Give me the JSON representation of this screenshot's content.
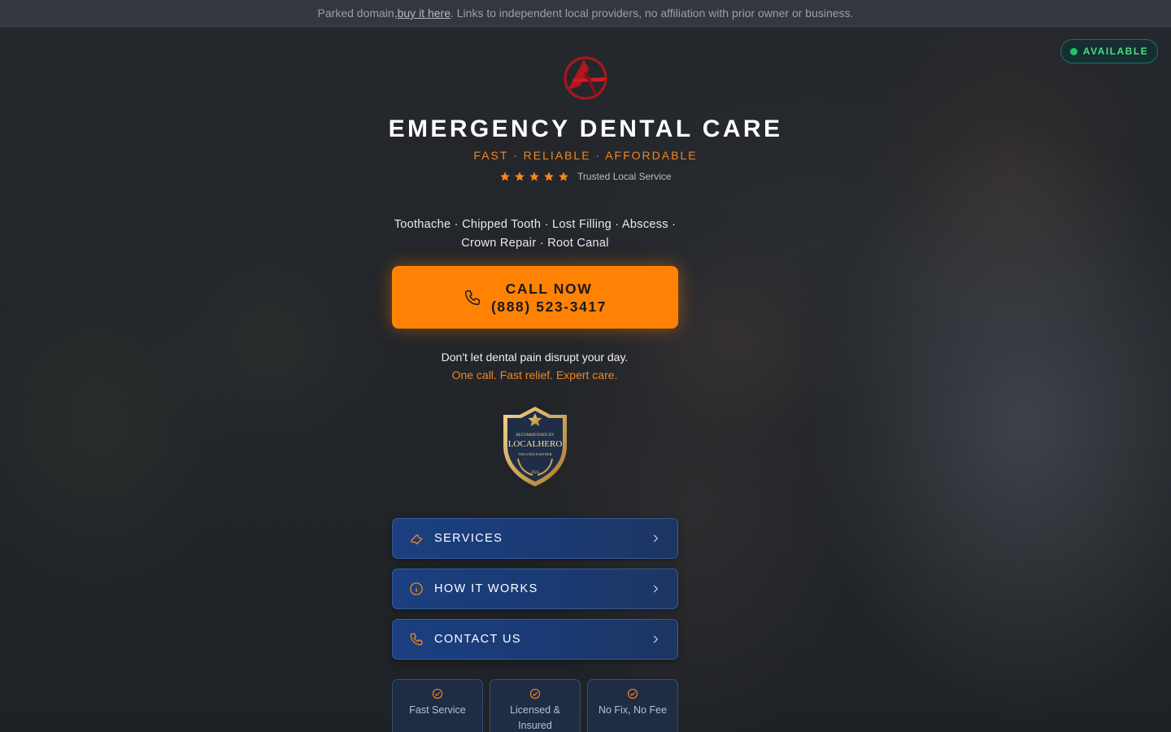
{
  "top_notice": {
    "prefix": "Parked domain, ",
    "link_label": "buy it here",
    "suffix": ". Links to independent local providers, no affiliation with prior owner or business."
  },
  "status_badge": {
    "label": "AVAILABLE",
    "color": "#22c55e"
  },
  "brand": {
    "title": "EMERGENCY DENTAL CARE",
    "tagline": "FAST · RELIABLE · AFFORDABLE",
    "rating_stars": 5,
    "rating_text": "Trusted Local Service",
    "accent_color": "#ff8205"
  },
  "conditions": {
    "line1": "Toothache · Chipped Tooth · Lost Filling · Abscess ·",
    "line2": "Crown Repair · Root Canal"
  },
  "call_button": {
    "label": "CALL NOW",
    "phone": "(888) 523-3417",
    "icon": "phone-icon"
  },
  "pitch": {
    "line1": "Don't let dental pain disrupt your day.",
    "line2": "One call. Fast relief. Expert care."
  },
  "trust_badge": {
    "top": "RECOMMENDED BY",
    "name": "LOCALHERO",
    "sub": "TRUSTED PARTNER",
    "year": "2025"
  },
  "nav": [
    {
      "label": "SERVICES",
      "icon": "wrench-icon"
    },
    {
      "label": "HOW IT WORKS",
      "icon": "info-icon"
    },
    {
      "label": "CONTACT US",
      "icon": "phone-icon"
    }
  ],
  "features": [
    {
      "label": "Fast Service"
    },
    {
      "label": "Licensed & Insured"
    },
    {
      "label": "No Fix, No Fee"
    }
  ]
}
